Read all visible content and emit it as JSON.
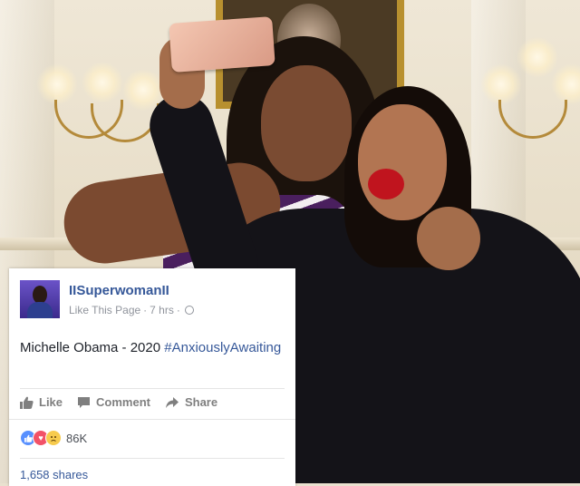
{
  "post": {
    "author": "IISuperwomanII",
    "like_page": "Like This Page",
    "time": "7 hrs",
    "text_prefix": "Michelle Obama - 2020 ",
    "hashtag": "#AnxiouslyAwaiting",
    "actions": {
      "like": "Like",
      "comment": "Comment",
      "share": "Share"
    },
    "reaction_count": "86K",
    "reaction_types": [
      "like-icon",
      "love-icon",
      "sad-icon"
    ],
    "shares": "1,658 shares"
  },
  "colors": {
    "link_blue": "#365899",
    "muted": "#90949c",
    "like_reaction": "#5890ff",
    "love_reaction": "#f25268",
    "sad_reaction": "#f7cb4d"
  }
}
